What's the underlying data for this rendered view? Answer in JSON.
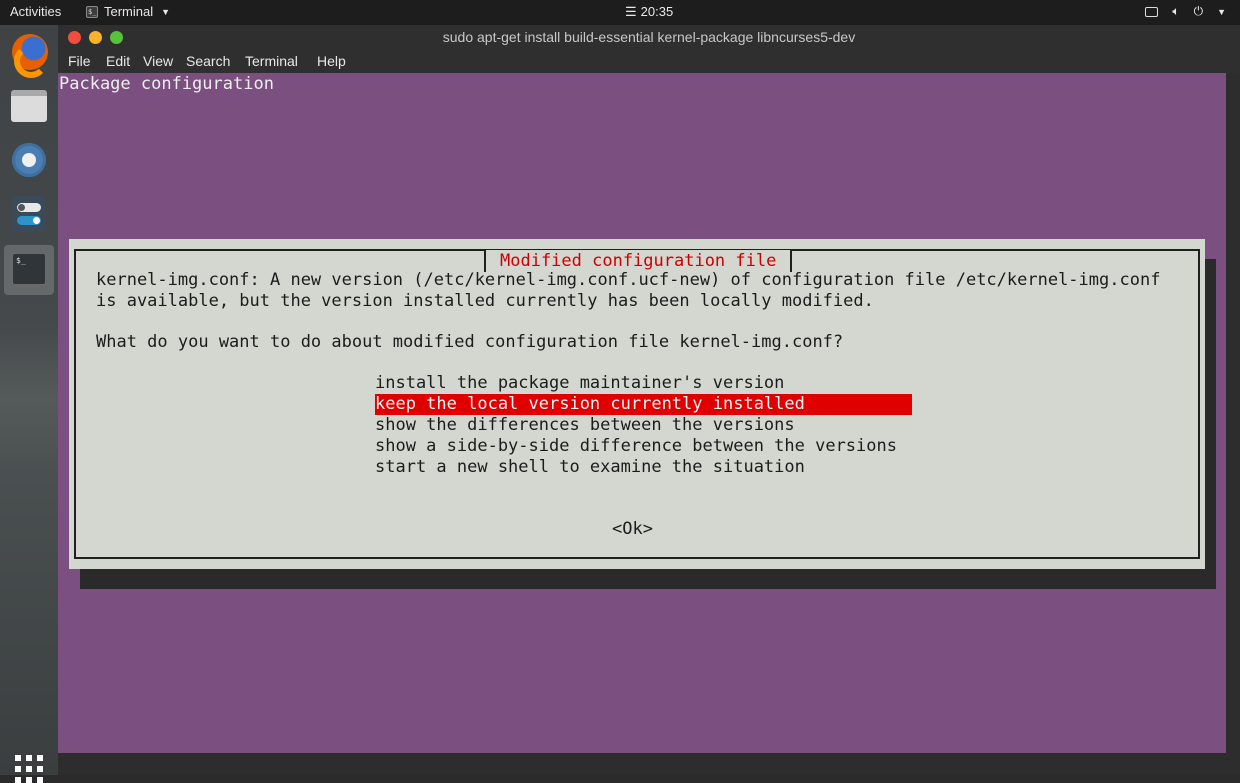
{
  "topbar": {
    "activities": "Activities",
    "app_name": "Terminal",
    "clock_icon": "☰",
    "time": "20:35"
  },
  "dock": {
    "items": [
      "firefox",
      "files",
      "settings",
      "tweaks",
      "terminal"
    ]
  },
  "window": {
    "title": "sudo apt-get install build-essential kernel-package libncurses5-dev",
    "menu": [
      "File",
      "Edit",
      "View",
      "Search",
      "Terminal",
      "Help"
    ]
  },
  "terminal": {
    "header": "Package configuration",
    "dialog": {
      "title": "Modified configuration file",
      "line1": "kernel-img.conf: A new version (/etc/kernel-img.conf.ucf-new) of configuration file /etc/kernel-img.conf",
      "line2": "is available, but the version installed currently has been locally modified.",
      "question": "What do you want to do about modified configuration file kernel-img.conf?",
      "options": [
        "install the package maintainer's version",
        "keep the local version currently installed",
        "show the differences between the versions",
        "show a side-by-side difference between the versions",
        "start a new shell to examine the situation"
      ],
      "selected_index": 1,
      "ok": "<Ok>"
    }
  },
  "colors": {
    "terminal_bg": "#7b4f80",
    "dialog_bg": "#d3d7cf",
    "highlight": "#e00000",
    "dialog_title": "#cc0000"
  }
}
